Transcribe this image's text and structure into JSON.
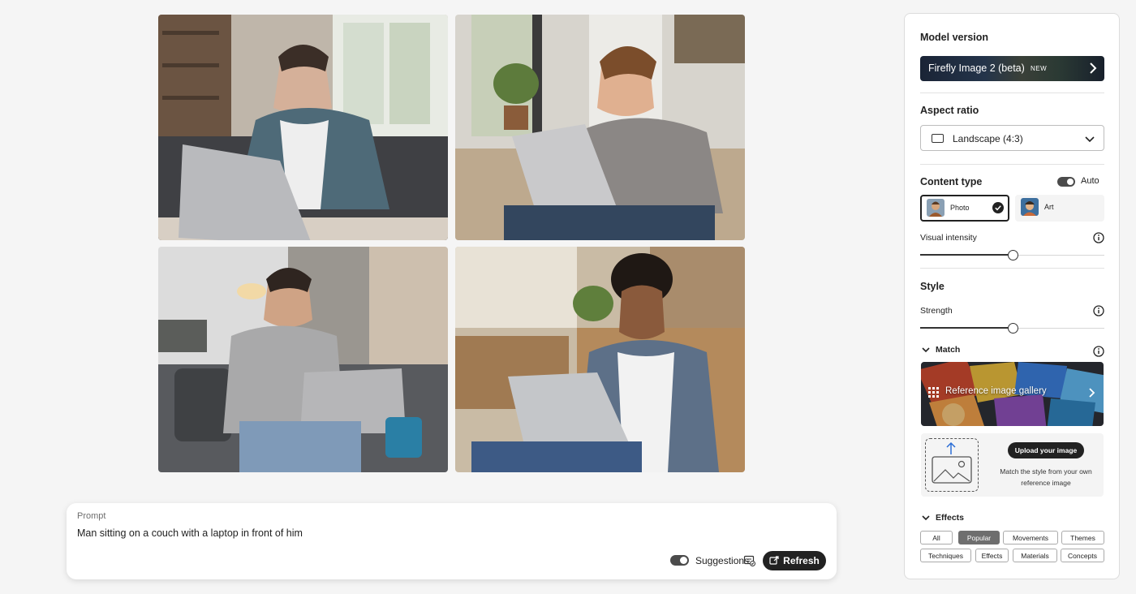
{
  "prompt": {
    "label": "Prompt",
    "text": "Man sitting on a couch with a laptop in front of him",
    "suggestions_label": "Suggestions",
    "suggestions_enabled": true,
    "refresh_label": "Refresh"
  },
  "panel": {
    "model": {
      "title": "Model version",
      "name": "Firefly Image 2 (beta)",
      "badge": "NEW"
    },
    "aspect": {
      "title": "Aspect ratio",
      "value": "Landscape (4:3)"
    },
    "content_type": {
      "title": "Content type",
      "auto_label": "Auto",
      "auto_enabled": true,
      "options": [
        {
          "label": "Photo",
          "selected": true
        },
        {
          "label": "Art",
          "selected": false
        }
      ]
    },
    "visual_intensity": {
      "label": "Visual intensity",
      "value": 0.5
    },
    "style": {
      "title": "Style",
      "strength_label": "Strength",
      "strength_value": 0.5,
      "match_label": "Match",
      "gallery_label": "Reference image gallery",
      "upload_button": "Upload your image",
      "upload_desc": "Match the style from your own reference image"
    },
    "effects": {
      "title": "Effects",
      "chips": [
        "All",
        "Popular",
        "Movements",
        "Themes",
        "Techniques",
        "Effects",
        "Materials",
        "Concepts"
      ],
      "active": "Popular"
    }
  },
  "colors": {
    "accent_dark": "#222222",
    "panel_bg": "#ffffff",
    "page_bg": "#f5f5f5"
  }
}
